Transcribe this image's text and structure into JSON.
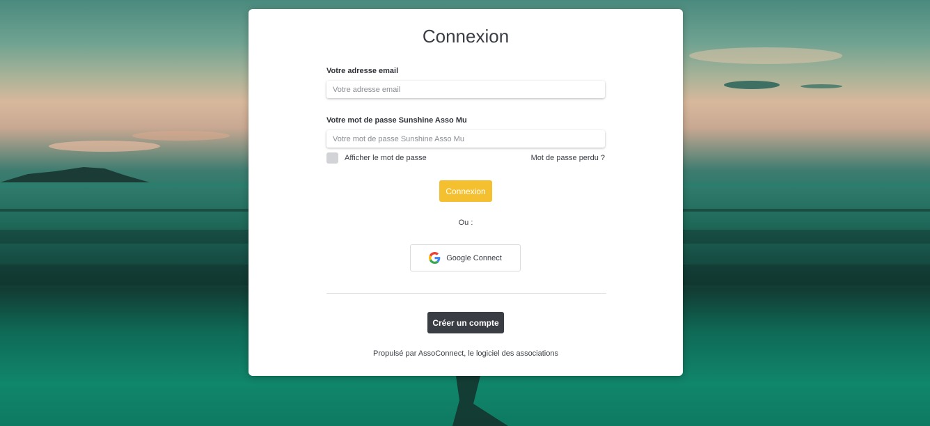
{
  "page": {
    "title": "Connexion"
  },
  "form": {
    "email_label": "Votre adresse email",
    "email_placeholder": "Votre adresse email",
    "email_value": "",
    "password_label": "Votre mot de passe Sunshine Asso Mu",
    "password_placeholder": "Votre mot de passe Sunshine Asso Mu",
    "password_value": "",
    "show_password_label": "Afficher le mot de passe",
    "show_password_checked": false,
    "forgot_password_label": "Mot de passe perdu ?",
    "login_button_label": "Connexion",
    "or_text": "Ou :",
    "google_button_label": "Google Connect",
    "google_icon": "google-g-icon",
    "create_account_label": "Créer un compte"
  },
  "footer": {
    "powered_by": "Propulsé par AssoConnect, le logiciel des associations"
  },
  "colors": {
    "accent": "#f4c02f",
    "dark_button": "#3a3d44",
    "text": "#3a3d44"
  }
}
